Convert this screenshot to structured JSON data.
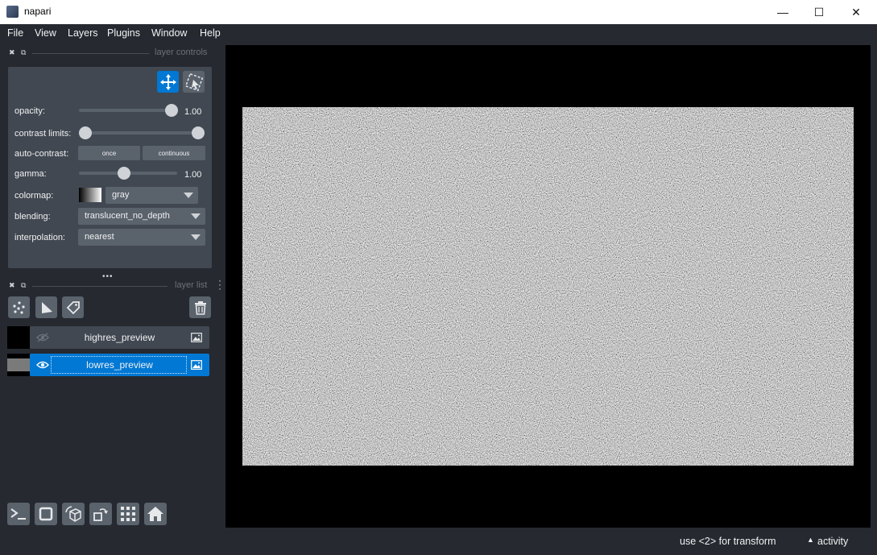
{
  "window": {
    "title": "napari",
    "minimize_glyph": "—",
    "maximize_glyph": "☐",
    "close_glyph": "✕"
  },
  "menu": [
    "File",
    "View",
    "Layers",
    "Plugins",
    "Window",
    "Help"
  ],
  "layer_controls": {
    "header": "layer controls",
    "opacity": {
      "label": "opacity:",
      "value": "1.00",
      "level": 1.0
    },
    "contrast_limits": {
      "label": "contrast limits:",
      "low": 0.0,
      "high": 1.0
    },
    "auto_contrast": {
      "label": "auto-contrast:",
      "once": "once",
      "continuous": "continuous"
    },
    "gamma": {
      "label": "gamma:",
      "value": "1.00",
      "level": 0.45
    },
    "colormap": {
      "label": "colormap:",
      "value": "gray"
    },
    "blending": {
      "label": "blending:",
      "value": "translucent_no_depth"
    },
    "interpolation": {
      "label": "interpolation:",
      "value": "nearest"
    }
  },
  "layer_list": {
    "header": "layer list",
    "layers": [
      {
        "name": "highres_preview",
        "visible": false,
        "selected": false
      },
      {
        "name": "lowres_preview",
        "visible": true,
        "selected": true
      }
    ]
  },
  "status": {
    "hint": "use <2> for transform",
    "activity": "activity",
    "activity_glyph": "▲"
  },
  "colors": {
    "background": "#262930",
    "panel": "#414851",
    "control": "#5a626c",
    "accent": "#0078d4",
    "text": "#f0f1f2"
  }
}
